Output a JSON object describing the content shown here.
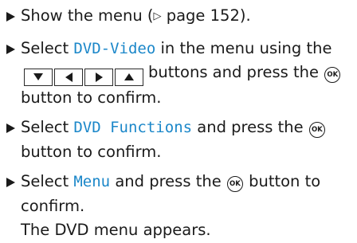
{
  "steps": [
    {
      "pre": "Show the menu (",
      "ref_icon": "▷",
      "ref_text": " page 152).",
      "post": ")."
    },
    {
      "pre": "Select ",
      "highlight": "DVD-Video",
      "mid": " in the menu using the ",
      "buttons": [
        "arrow-down-icon",
        "arrow-left-icon",
        "arrow-right-icon",
        "arrow-up-icon"
      ],
      "after_buttons": "buttons and press the ",
      "ok_label": "OK",
      "post": " button to confirm."
    },
    {
      "pre": "Select ",
      "highlight": "DVD Functions",
      "mid": " and press the ",
      "ok_label": "OK",
      "post": " button to confirm."
    },
    {
      "pre": "Select ",
      "highlight": "Menu",
      "mid": " and press the ",
      "ok_label": "OK",
      "post": " button to confirm.",
      "result": "The DVD menu appears."
    }
  ],
  "colors": {
    "highlight": "#1b87c9",
    "text": "#1a1a1a"
  }
}
